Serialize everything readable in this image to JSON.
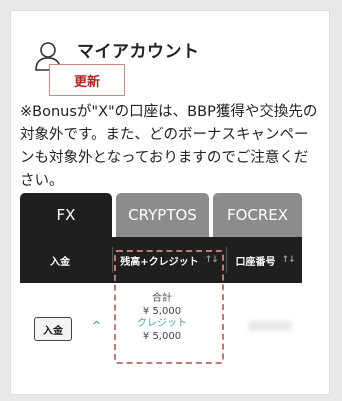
{
  "header": {
    "title": "マイアカウント",
    "refresh_label": "更新"
  },
  "notice": "※Bonusが\"X\"の口座は、BBP獲得や交換先の対象外です。また、どのボーナスキャンペーンも対象外となっておりますのでご注意ください。",
  "tabs": [
    {
      "label": "FX",
      "active": true
    },
    {
      "label": "CRYPTOS",
      "active": false
    },
    {
      "label": "FOCREX",
      "active": false
    }
  ],
  "table": {
    "columns": [
      {
        "label": "入金"
      },
      {
        "label": "残高+クレジット",
        "sort": "↑↓"
      },
      {
        "label": "口座番号",
        "sort": "↑↓"
      }
    ],
    "row": {
      "deposit_label": "入金",
      "total_label": "合計",
      "total_value": "¥ 5,000",
      "credit_label": "クレジット",
      "credit_value": "¥ 5,000"
    }
  },
  "icons": {
    "user": "user-icon",
    "expand": "chevron-up-icon"
  },
  "colors": {
    "refresh_border": "#c9888a",
    "refresh_text": "#b22222",
    "highlight_dashed": "#c07878",
    "credit_label": "#55a3a0",
    "expand_chevron": "#2a9d4a"
  }
}
